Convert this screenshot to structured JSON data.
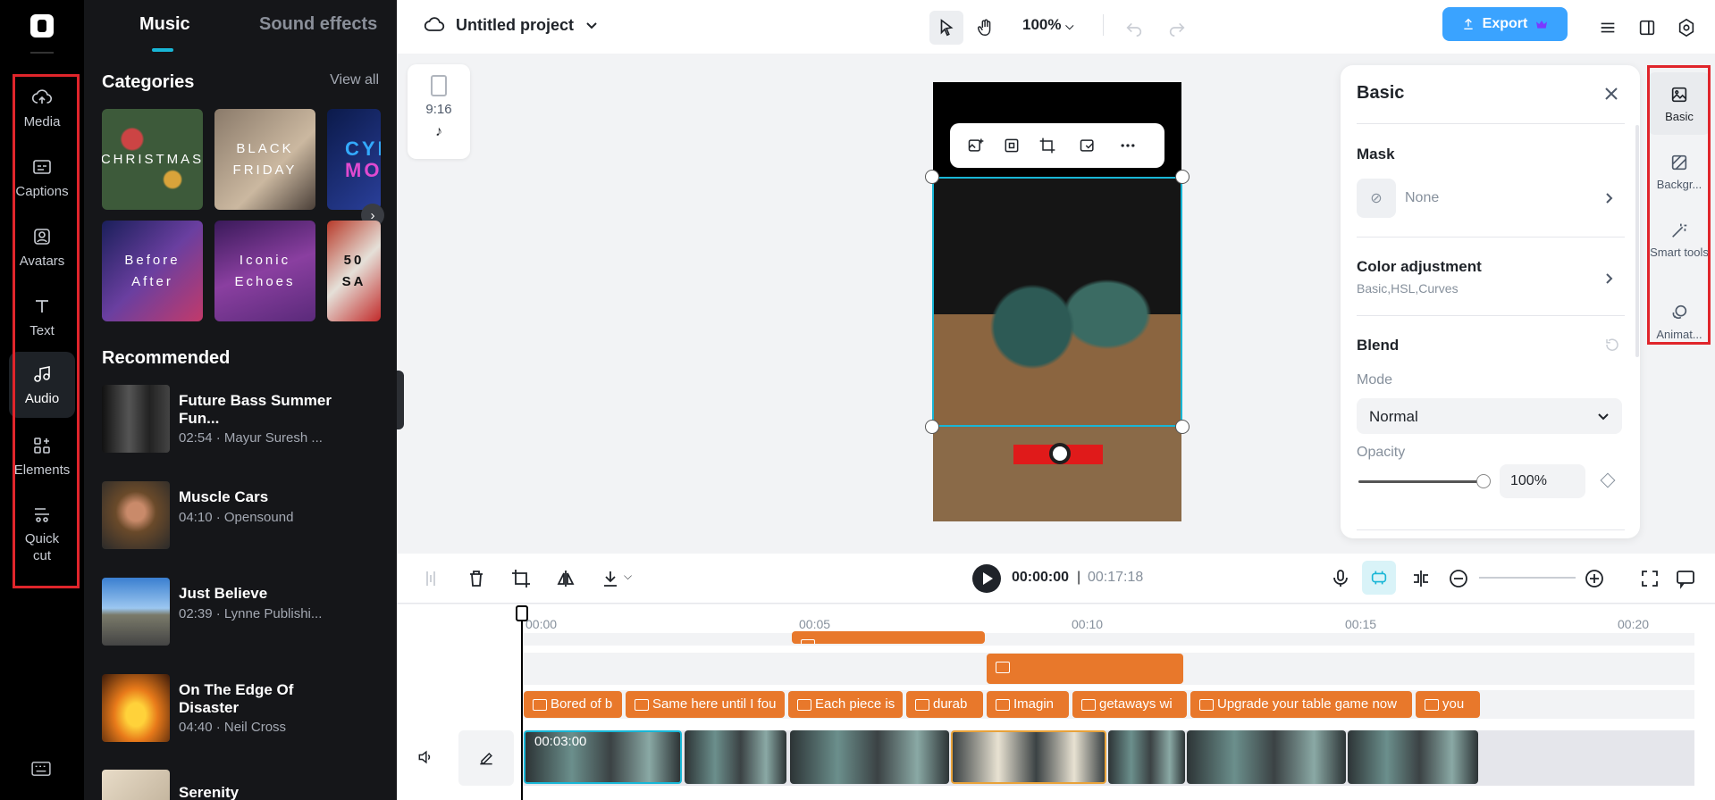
{
  "rail": {
    "items": [
      {
        "label": "Media",
        "icon": "cloud-upload-icon"
      },
      {
        "label": "Captions",
        "icon": "captions-icon"
      },
      {
        "label": "Avatars",
        "icon": "avatar-icon"
      },
      {
        "label": "Text",
        "icon": "text-icon"
      },
      {
        "label": "Audio",
        "icon": "music-note-icon"
      },
      {
        "label": "Elements",
        "icon": "elements-icon"
      },
      {
        "label": "Quick",
        "label2": "cut",
        "icon": "scissors-icon"
      }
    ],
    "active": "Audio"
  },
  "library": {
    "tabs": [
      "Music",
      "Sound effects"
    ],
    "categories_title": "Categories",
    "view_all": "View all",
    "categories": [
      {
        "line1": "CHRISTMAS",
        "line2": ""
      },
      {
        "line1": "BLACK",
        "line2": "FRIDAY"
      },
      {
        "line1": "CYB",
        "line2": "MON"
      },
      {
        "line1": "Before",
        "line2": "After"
      },
      {
        "line1": "Iconic",
        "line2": "Echoes"
      },
      {
        "line1": "50",
        "line2": "SA"
      }
    ],
    "recommended_title": "Recommended",
    "tracks": [
      {
        "title": "Future Bass Summer Fun...",
        "meta": "02:54 · Mayur Suresh ..."
      },
      {
        "title": "Muscle Cars",
        "meta": "04:10 · Opensound"
      },
      {
        "title": "Just Believe",
        "meta": "02:39 · Lynne Publishi..."
      },
      {
        "title": "On The Edge Of Disaster",
        "meta": "04:40 · Neil Cross"
      },
      {
        "title": "Serenity",
        "meta": ""
      }
    ]
  },
  "topbar": {
    "project_name": "Untitled project",
    "zoom": "100%",
    "export_label": "Export"
  },
  "canvas": {
    "aspect_ratio": "9:16"
  },
  "panel": {
    "title": "Basic",
    "mask_label": "Mask",
    "mask_value": "None",
    "color_adj_label": "Color adjustment",
    "color_adj_sub": "Basic,HSL,Curves",
    "blend_label": "Blend",
    "mode_label": "Mode",
    "mode_value": "Normal",
    "opacity_label": "Opacity",
    "opacity_value": "100%"
  },
  "right_tools": [
    {
      "label": "Basic",
      "icon": "image-icon"
    },
    {
      "label": "Backgr...",
      "icon": "background-icon"
    },
    {
      "label": "Smart tools",
      "icon": "magic-wand-icon"
    },
    {
      "label": "Animat...",
      "icon": "animation-icon"
    }
  ],
  "timeline": {
    "current_time": "00:00:00",
    "separator": "|",
    "total_time": "00:17:18",
    "ruler": [
      "00:00",
      "00:05",
      "00:10",
      "00:15",
      "00:20"
    ],
    "captions": [
      "Bored of b",
      "Same here until I fou",
      "Each piece is",
      "durab",
      "Imagin",
      "getaways wi",
      "Upgrade your table game now",
      "you"
    ],
    "clip_time": "00:03:00"
  },
  "colors": {
    "accent": "#18b6d6",
    "export": "#3aa3ff",
    "caption_clip": "#e8782b",
    "highlight": "#e0252b"
  }
}
